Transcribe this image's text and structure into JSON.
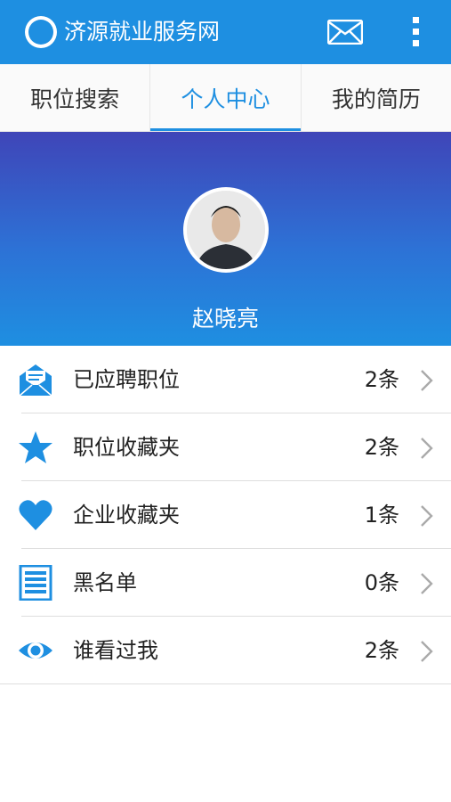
{
  "app": {
    "title": "济源就业服务网",
    "brand_color": "#1e8fe1"
  },
  "header_icons": [
    "mail-icon",
    "more-vertical-icon"
  ],
  "tabs": [
    {
      "label": "职位搜索",
      "active": false
    },
    {
      "label": "个人中心",
      "active": true
    },
    {
      "label": "我的简历",
      "active": false
    }
  ],
  "profile": {
    "name": "赵晓亮"
  },
  "menu": [
    {
      "label": "已应聘职位",
      "count": "2条",
      "icon": "envelope-open-icon"
    },
    {
      "label": "职位收藏夹",
      "count": "2条",
      "icon": "star-icon"
    },
    {
      "label": "企业收藏夹",
      "count": "1条",
      "icon": "heart-icon"
    },
    {
      "label": "黑名单",
      "count": "0条",
      "icon": "list-icon"
    },
    {
      "label": "谁看过我",
      "count": "2条",
      "icon": "eye-icon"
    }
  ]
}
